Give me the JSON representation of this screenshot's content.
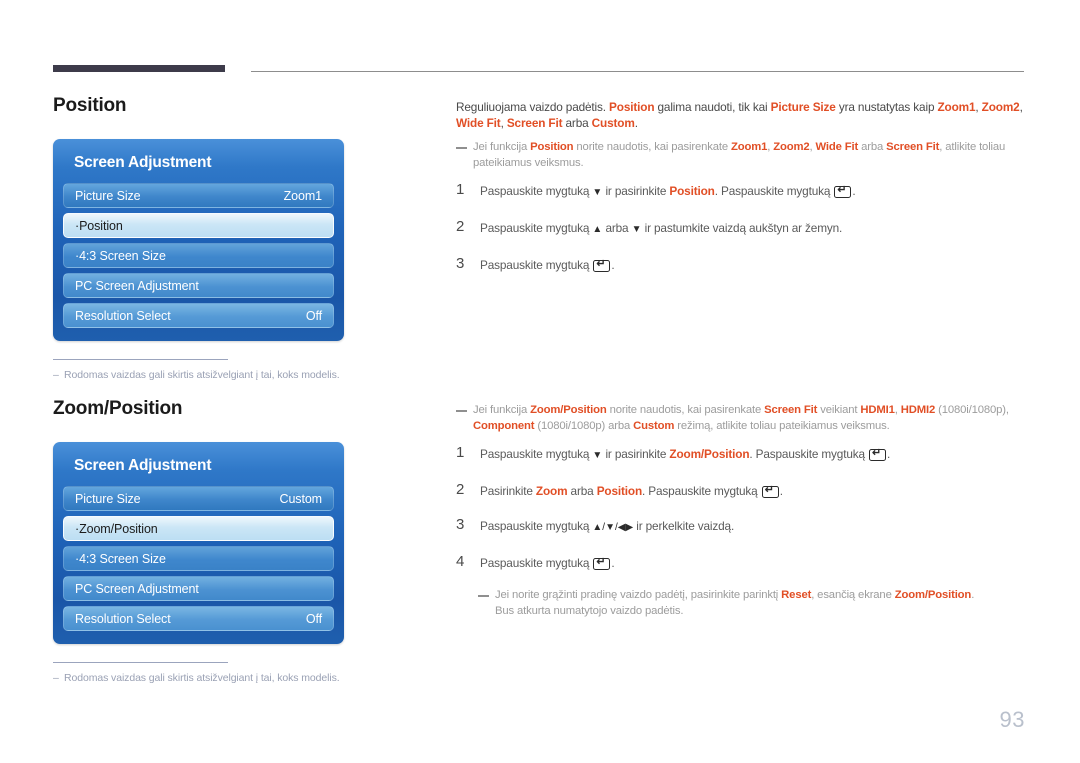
{
  "page": {
    "number": "93"
  },
  "sections": [
    {
      "title": "Position",
      "osd": {
        "title": "Screen Adjustment",
        "rows": [
          {
            "label": "Picture Size",
            "value": "Zoom1",
            "selected": false
          },
          {
            "label": "·Position",
            "value": "",
            "selected": true
          },
          {
            "label": "·4:3 Screen Size",
            "value": "",
            "selected": false
          },
          {
            "label": "PC Screen Adjustment",
            "value": "",
            "selected": false
          },
          {
            "label": "Resolution Select",
            "value": "Off",
            "selected": false
          }
        ]
      },
      "footnote": "Rodomas vaizdas gali skirtis atsižvelgiant į tai, koks modelis.",
      "intro": {
        "p1_a": "Reguliuojama vaizdo padėtis. ",
        "p1_b": "Position",
        "p1_c": " galima naudoti, tik kai ",
        "p1_d": "Picture Size",
        "p1_e": " yra nustatytas kaip ",
        "p1_f": "Zoom1",
        "p1_g": ", ",
        "p1_h": "Zoom2",
        "p1_i": ", ",
        "p1_j": "Wide Fit",
        "p1_k": ", ",
        "p1_l": "Screen Fit",
        "p1_m": " arba ",
        "p1_n": "Custom",
        "p1_o": "."
      },
      "note": {
        "a": "Jei funkcija ",
        "b": "Position",
        "c": " norite naudotis, kai pasirenkate ",
        "d": "Zoom1",
        "e": ", ",
        "f": "Zoom2",
        "g": ", ",
        "h": "Wide Fit",
        "i": " arba ",
        "j": "Screen Fit",
        "k": ", atlikite toliau pateikiamus veiksmus."
      },
      "steps": [
        {
          "num": "1",
          "a": "Paspauskite mygtuką ",
          "arrow": "▼",
          "b": " ir pasirinkite ",
          "hl": "Position",
          "c": ". Paspauskite mygtuką ",
          "d": ".",
          "enter_first": false,
          "enter_last": true
        },
        {
          "num": "2",
          "a": "Paspauskite mygtuką ",
          "arrow": "▲",
          "b": " arba ",
          "arrow2": "▼",
          "c": " ir pastumkite vaizdą aukštyn ar žemyn.",
          "enter_last": false
        },
        {
          "num": "3",
          "a": "Paspauskite mygtuką ",
          "d": ".",
          "enter_last": true
        }
      ]
    },
    {
      "title": "Zoom/Position",
      "osd": {
        "title": "Screen Adjustment",
        "rows": [
          {
            "label": "Picture Size",
            "value": "Custom",
            "selected": false
          },
          {
            "label": "·Zoom/Position",
            "value": "",
            "selected": true
          },
          {
            "label": "·4:3 Screen Size",
            "value": "",
            "selected": false
          },
          {
            "label": "PC Screen Adjustment",
            "value": "",
            "selected": false
          },
          {
            "label": "Resolution Select",
            "value": "Off",
            "selected": false
          }
        ]
      },
      "footnote": "Rodomas vaizdas gali skirtis atsižvelgiant į tai, koks modelis.",
      "note": {
        "a": "Jei funkcija ",
        "b": "Zoom/Position",
        "c": " norite naudotis, kai pasirenkate ",
        "d": "Screen Fit",
        "e": " veikiant ",
        "f": "HDMI1",
        "g": ", ",
        "h": "HDMI2",
        "i": " (1080i/1080p), ",
        "j": "Component",
        "k": " (1080i/1080p) arba ",
        "l": "Custom",
        "m": " režimą, atlikite toliau pateikiamus veiksmus."
      },
      "steps": [
        {
          "num": "1",
          "a": "Paspauskite mygtuką ",
          "arrow": "▼",
          "b": " ir pasirinkite ",
          "hl": "Zoom/Position",
          "c": ". Paspauskite mygtuką ",
          "d": ".",
          "enter_last": true
        },
        {
          "num": "2",
          "a": "Pasirinkite ",
          "hl": "Zoom",
          "b": " arba ",
          "hl2": "Position",
          "c": ". Paspauskite mygtuką ",
          "d": ".",
          "enter_last": true
        },
        {
          "num": "3",
          "a": "Paspauskite mygtuką ",
          "arrow": "▲/▼/◀▶",
          "c": " ir perkelkite vaizdą.",
          "enter_last": false
        },
        {
          "num": "4",
          "a": "Paspauskite mygtuką ",
          "d": ".",
          "enter_last": true
        }
      ],
      "endnote": {
        "a": "Jei norite grąžinti pradinę vaizdo padėtį, pasirinkite parinktį ",
        "b": "Reset",
        "c": ", esančią ekrane ",
        "d": "Zoom/Position",
        "e": ".",
        "f": "Bus atkurta numatytojo vaizdo padėtis."
      }
    }
  ]
}
